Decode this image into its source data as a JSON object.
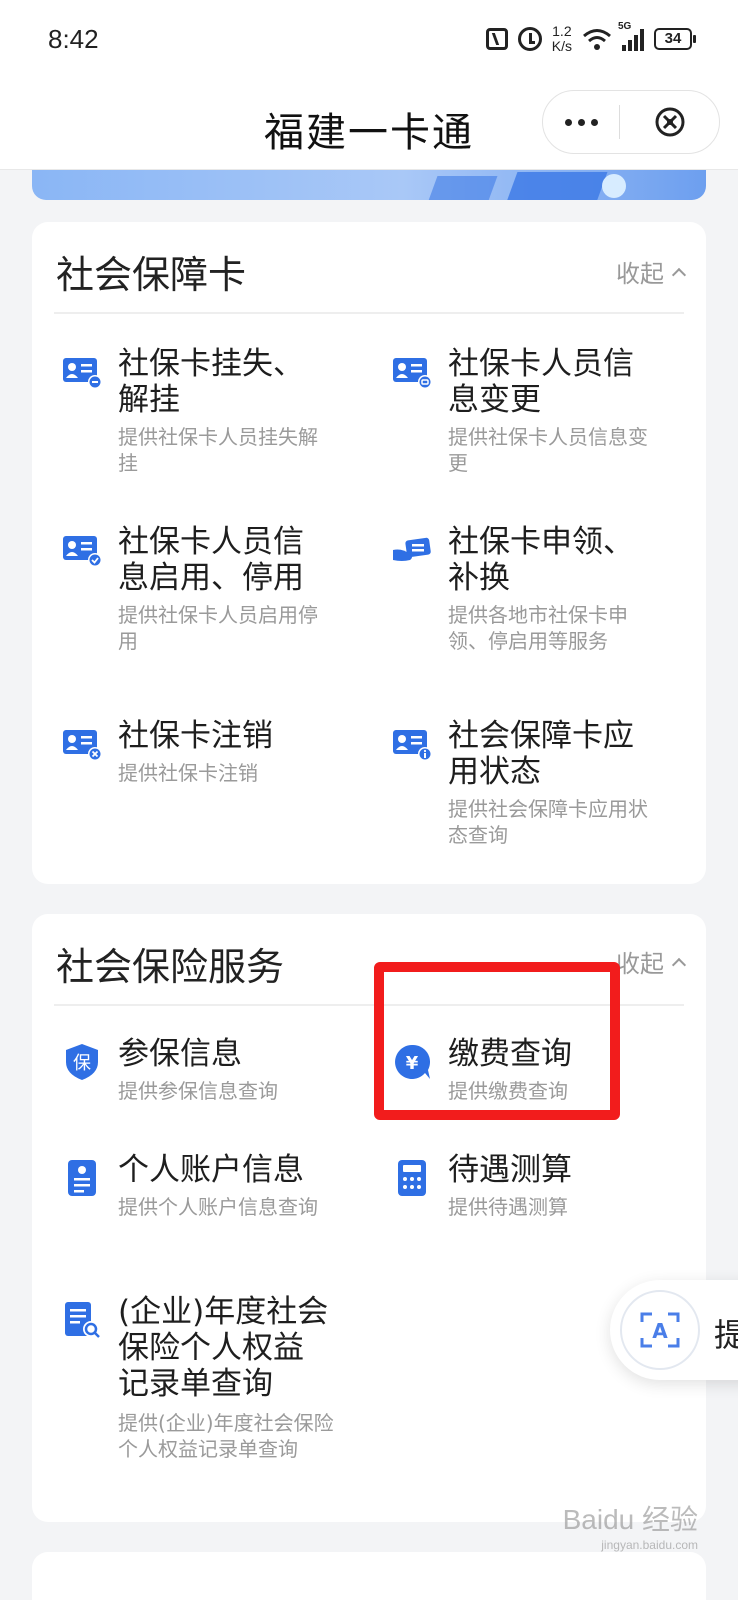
{
  "status_bar": {
    "time": "8:42",
    "speed_value": "1.2",
    "speed_unit": "K/s",
    "network": "5G",
    "battery": "34"
  },
  "header": {
    "title": "福建一卡通"
  },
  "social_security_card": {
    "title": "社会保障卡",
    "collapse_label": "收起",
    "items": [
      {
        "title": "社保卡挂失、解挂",
        "desc": "提供社保卡人员挂失解挂",
        "icon": "id-card-minus-icon"
      },
      {
        "title": "社保卡人员信息变更",
        "desc": "提供社保卡人员信息变更",
        "icon": "id-card-edit-icon"
      },
      {
        "title": "社保卡人员信息启用、停用",
        "desc": "提供社保卡人员启用停用",
        "icon": "id-card-check-icon"
      },
      {
        "title": "社保卡申领、补换",
        "desc": "提供各地市社保卡申领、停启用等服务",
        "icon": "card-hand-icon"
      },
      {
        "title": "社保卡注销",
        "desc": "提供社保卡注销",
        "icon": "id-card-cancel-icon"
      },
      {
        "title": "社会保障卡应用状态",
        "desc": "提供社会保障卡应用状态查询",
        "icon": "id-card-info-icon"
      }
    ]
  },
  "social_insurance_service": {
    "title": "社会保险服务",
    "collapse_label": "收起",
    "items": [
      {
        "title": "参保信息",
        "desc": "提供参保信息查询",
        "icon": "shield-bao-icon",
        "icon_text": "保"
      },
      {
        "title": "缴费查询",
        "desc": "提供缴费查询",
        "icon": "yuan-chat-icon",
        "icon_text": "¥"
      },
      {
        "title": "个人账户信息",
        "desc": "提供个人账户信息查询",
        "icon": "account-doc-icon"
      },
      {
        "title": "待遇测算",
        "desc": "提供待遇测算",
        "icon": "calculator-icon"
      },
      {
        "title": "(企业)年度社会保险个人权益记录单查询",
        "desc": "提供(企业)年度社会保险个人权益记录单查询",
        "icon": "doc-search-icon"
      }
    ]
  },
  "floating_button": {
    "icon_text": "A",
    "label": "提"
  },
  "watermark": {
    "text": "Baidu 经验",
    "sub": "jingyan.baidu.com"
  },
  "colors": {
    "accent_blue": "#2f6fe4",
    "highlight_red": "#f21c1c"
  }
}
